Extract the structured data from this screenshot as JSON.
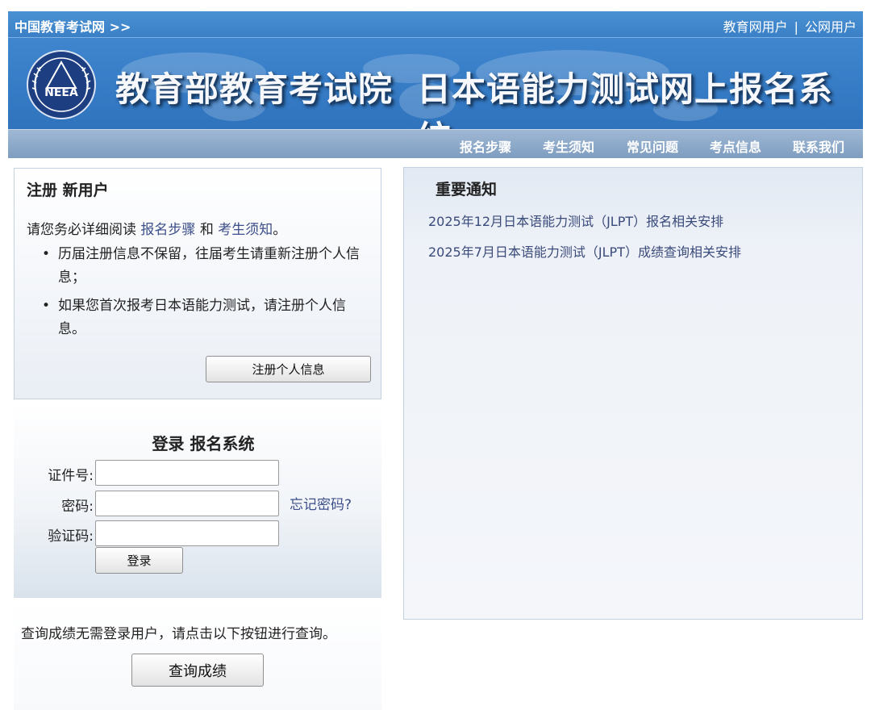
{
  "topbar": {
    "home_link": "中国教育考试网 >>",
    "user_edu": "教育网用户",
    "separator": "|",
    "user_public": "公网用户"
  },
  "banner": {
    "logo_text": "NEEA",
    "title_left": "教育部教育考试院",
    "title_right": "日本语能力测试网上报名系统"
  },
  "nav": {
    "items": [
      "报名步骤",
      "考生须知",
      "常见问题",
      "考点信息",
      "联系我们"
    ]
  },
  "register": {
    "heading": "注册 新用户",
    "intro_prefix": "请您务必详细阅读",
    "link_steps": "报名步骤",
    "intro_and": "和",
    "link_notice": "考生须知",
    "intro_suffix": "。",
    "bullets": [
      "历届注册信息不保留，往届考生请重新注册个人信息；",
      "如果您首次报考日本语能力测试，请注册个人信息。"
    ],
    "button": "注册个人信息"
  },
  "login": {
    "heading": "登录 报名系统",
    "id_label": "证件号:",
    "password_label": "密码:",
    "captcha_label": "验证码:",
    "id_value": "",
    "password_value": "",
    "captcha_value": "",
    "forgot": "忘记密码?",
    "button": "登录"
  },
  "query": {
    "text": "查询成绩无需登录用户，请点击以下按钮进行查询。",
    "button": "查询成绩"
  },
  "notice": {
    "heading": "重要通知",
    "items": [
      "2025年12月日本语能力测试（JLPT）报名相关安排",
      "2025年7月日本语能力测试（JLPT）成绩查询相关安排"
    ]
  },
  "colors": {
    "header_blue": "#3b80c6",
    "nav_gray_blue": "#8aa7c8",
    "link": "#3d4f8a"
  }
}
